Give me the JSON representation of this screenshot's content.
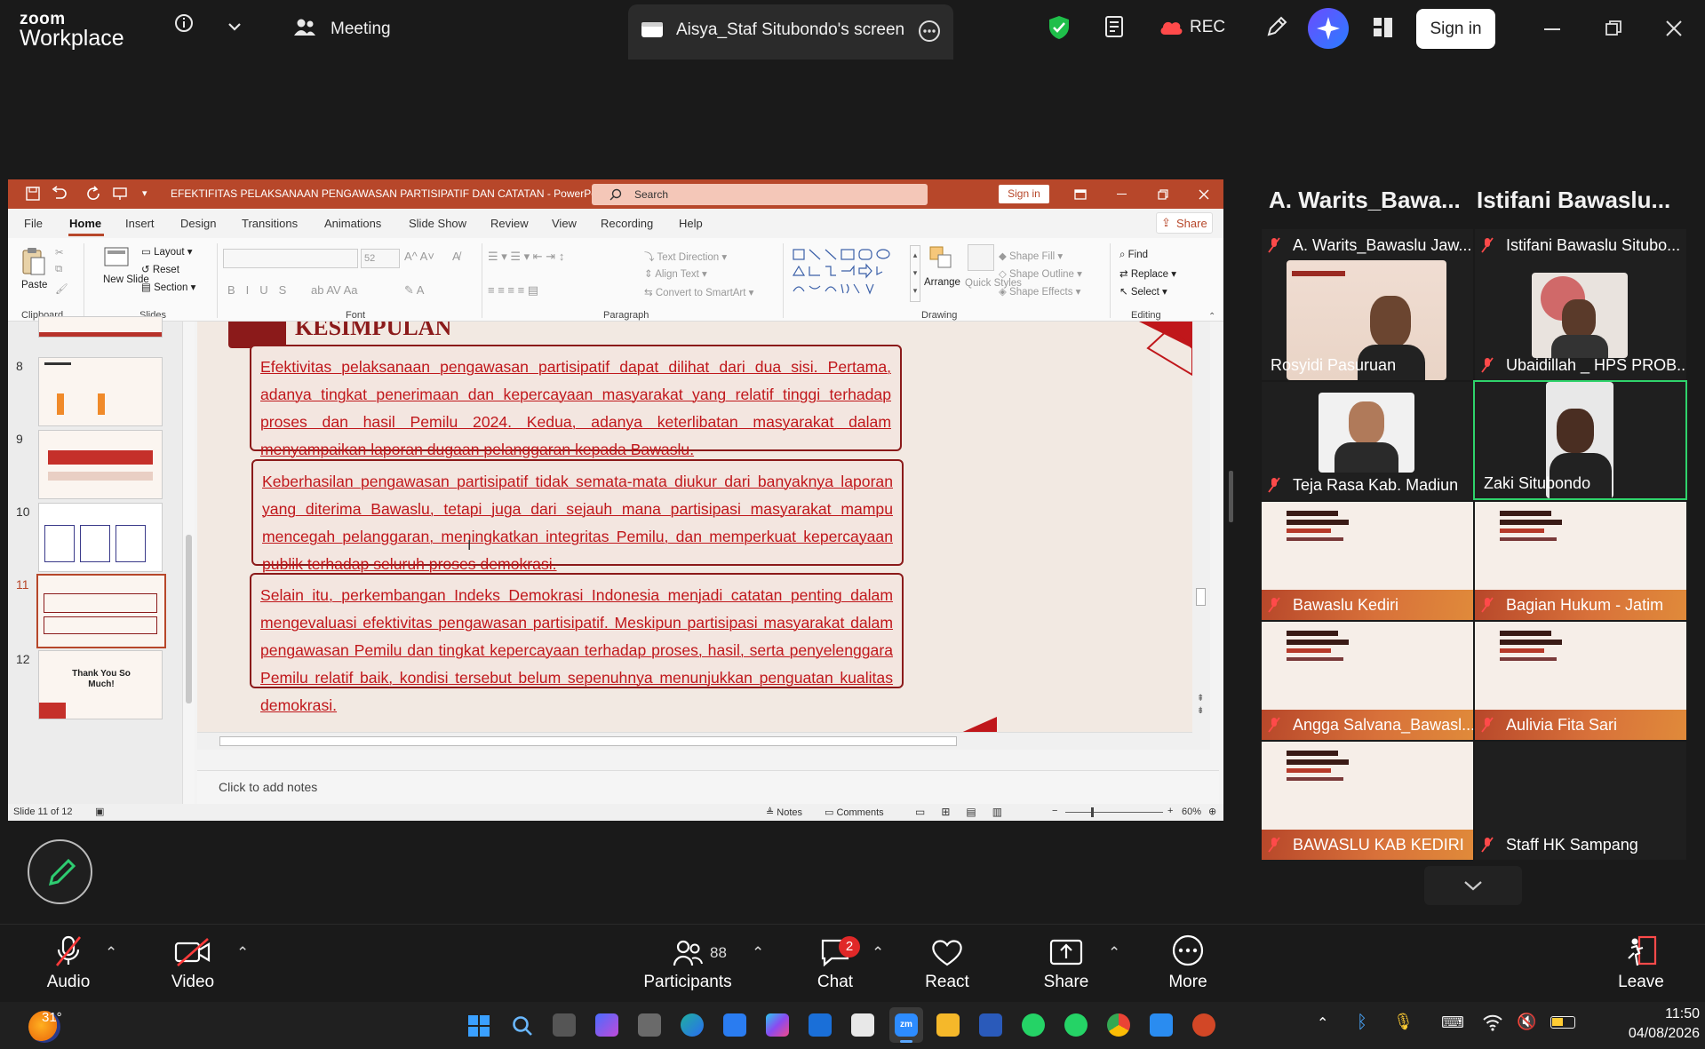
{
  "zoom": {
    "brand_line1": "zoom",
    "brand_line2": "Workplace",
    "meeting_label": "Meeting",
    "share_title": "Aisya_Staf Situbondo's screen",
    "rec_label": "REC",
    "sign_in": "Sign in"
  },
  "ppt": {
    "title": "EFEKTIFITAS PELAKSANAAN PENGAWASAN PARTISIPATIF DAN CATATAN  -  PowerPoint",
    "search_placeholder": "Search",
    "sign_in": "Sign in",
    "share": "Share",
    "menu": [
      "File",
      "Home",
      "Insert",
      "Design",
      "Transitions",
      "Animations",
      "Slide Show",
      "Review",
      "View",
      "Recording",
      "Help"
    ],
    "ribbon": {
      "paste": "Paste",
      "layout": "Layout",
      "reset": "Reset",
      "new_slide": "New Slide",
      "section": "Section",
      "font_size": "52",
      "text_direction": "Text Direction",
      "align_text": "Align Text",
      "convert_smartart": "Convert to SmartArt",
      "arrange": "Arrange",
      "quick_styles": "Quick Styles",
      "shape_fill": "Shape Fill",
      "shape_outline": "Shape Outline",
      "shape_effects": "Shape Effects",
      "find": "Find",
      "replace": "Replace",
      "select": "Select",
      "groups": [
        "Clipboard",
        "Slides",
        "Font",
        "Paragraph",
        "Drawing",
        "Editing"
      ]
    },
    "thumb_numbers": [
      "8",
      "9",
      "10",
      "11",
      "12"
    ],
    "thumb12_text": "Thank You So Much!",
    "slide_heading": "KESIMPULAN",
    "paragraphs": [
      "Efektivitas pelaksanaan pengawasan partisipatif dapat dilihat dari dua sisi. Pertama, adanya tingkat penerimaan dan kepercayaan masyarakat yang relatif tinggi terhadap proses dan hasil Pemilu 2024. Kedua, adanya keterlibatan masyarakat dalam menyampaikan laporan dugaan pelanggaran kepada Bawaslu.",
      "Keberhasilan pengawasan partisipatif tidak semata-mata diukur dari banyaknya laporan yang diterima Bawaslu, tetapi juga dari sejauh mana partisipasi masyarakat mampu mencegah pelanggaran, meningkatkan integritas Pemilu, dan memperkuat kepercayaan publik terhadap seluruh proses demokrasi.",
      "Selain itu, perkembangan Indeks Demokrasi Indonesia menjadi catatan penting dalam mengevaluasi efektivitas pengawasan partisipatif. Meskipun partisipasi masyarakat dalam pengawasan Pemilu dan tingkat kepercayaan terhadap proses, hasil, serta penyelenggara Pemilu relatif baik, kondisi tersebut belum sepenuhnya menunjukkan penguatan kualitas demokrasi."
    ],
    "notes_placeholder": "Click to add notes",
    "status_slide": "Slide 11 of 12",
    "status_notes": "Notes",
    "status_comments": "Comments",
    "zoom_pct": "60%"
  },
  "gallery": {
    "header_names": [
      "A.  Warits_Bawa...",
      "Istifani  Bawaslu..."
    ],
    "tiles": [
      {
        "name": "A. Warits_Bawaslu Jaw..."
      },
      {
        "name": "Istifani Bawaslu Situbo..."
      },
      {
        "name": "Rosyidi Pasuruan"
      },
      {
        "name": "Ubaidillah _ HPS PROB..."
      },
      {
        "name": "Teja Rasa Kab. Madiun"
      },
      {
        "name": "Zaki Situbondo"
      },
      {
        "name": "Bawaslu Kediri"
      },
      {
        "name": "Bagian Hukum - Jatim"
      },
      {
        "name": "Angga Salvana_Bawasl..."
      },
      {
        "name": "Aulivia Fita Sari"
      },
      {
        "name": "BAWASLU KAB KEDIRI"
      },
      {
        "name": "Staff HK Sampang"
      }
    ]
  },
  "controls": {
    "audio": "Audio",
    "video": "Video",
    "participants": "Participants",
    "participants_count": "88",
    "chat": "Chat",
    "chat_badge": "2",
    "react": "React",
    "share": "Share",
    "more": "More",
    "leave": "Leave"
  },
  "taskbar": {
    "temperature": "31°",
    "time": "11:50",
    "date": "04/08/2026"
  }
}
